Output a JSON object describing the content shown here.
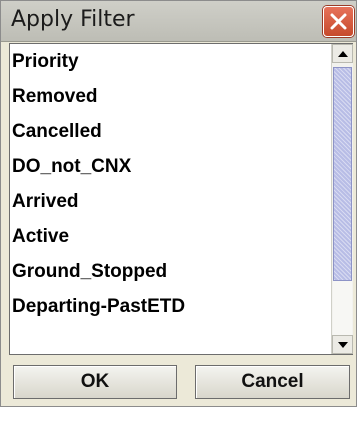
{
  "dialog": {
    "title": "Apply Filter",
    "close_icon": "close-icon"
  },
  "filter_list": {
    "items": [
      {
        "label": "Priority"
      },
      {
        "label": "Removed"
      },
      {
        "label": "Cancelled"
      },
      {
        "label": "DO_not_CNX"
      },
      {
        "label": "Arrived"
      },
      {
        "label": "Active"
      },
      {
        "label": "Ground_Stopped"
      },
      {
        "label": "Departing-PastETD"
      }
    ]
  },
  "scrollbar": {
    "up_icon": "scroll-up-arrow-icon",
    "down_icon": "scroll-down-arrow-icon"
  },
  "buttons": {
    "ok_label": "OK",
    "cancel_label": "Cancel"
  },
  "colors": {
    "dialog_background": "#ece9d8",
    "close_button": "#d9583a",
    "scroll_thumb": "#b8bde6"
  }
}
